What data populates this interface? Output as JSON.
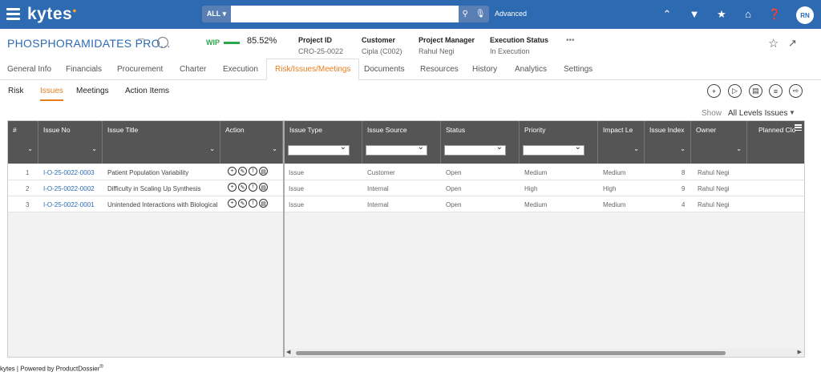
{
  "app": {
    "logo": "kytes",
    "logo_mark": "●"
  },
  "search": {
    "scope": "ALL ▾",
    "placeholder": "",
    "value": "",
    "advanced": "Advanced"
  },
  "user": {
    "initials": "RN"
  },
  "project": {
    "title": "PHOSPHORAMIDATES PRO...",
    "status_tag": "WIP",
    "progress_pct": "85.52%",
    "progress": 0.8552,
    "id_label": "Project ID",
    "id_value": "CRO-25-0022",
    "customer_label": "Customer",
    "customer_value": "Cipla (C002)",
    "manager_label": "Project Manager",
    "manager_value": "Rahul Negi",
    "exec_label": "Execution Status",
    "exec_value": "In Execution",
    "more": "•••"
  },
  "main_tabs": [
    "General Info",
    "Financials",
    "Procurement",
    "Charter",
    "Execution",
    "Risk/Issues/Meetings",
    "Documents",
    "Resources",
    "History",
    "Analytics",
    "Settings"
  ],
  "sub_tabs": [
    "Risk",
    "Issues",
    "Meetings",
    "Action Items"
  ],
  "filter": {
    "show_label": "Show",
    "level_value": "All Levels Issues"
  },
  "columns": [
    "#",
    "Issue No",
    "Issue Title",
    "Action",
    "Issue Type",
    "Issue Source",
    "Status",
    "Priority",
    "Impact Le",
    "Issue Index",
    "Owner",
    "Planned Clo"
  ],
  "rows": [
    {
      "num": "1",
      "issue_no": "I-O-25-0022-0003",
      "title": "Patient Population Variability",
      "type": "Issue",
      "source": "Customer",
      "status": "Open",
      "priority": "Medium",
      "impact": "Medium",
      "index": "8",
      "owner": "Rahul Negi"
    },
    {
      "num": "2",
      "issue_no": "I-O-25-0022-0002",
      "title": "Difficulty in Scaling Up Synthesis",
      "type": "Issue",
      "source": "Internal",
      "status": "Open",
      "priority": "High",
      "impact": "High",
      "index": "9",
      "owner": "Rahul Negi"
    },
    {
      "num": "3",
      "issue_no": "I-O-25-0022-0001",
      "title": "Unintended Interactions with Biological",
      "type": "Issue",
      "source": "Internal",
      "status": "Open",
      "priority": "Medium",
      "impact": "Medium",
      "index": "4",
      "owner": "Rahul Negi"
    }
  ],
  "footer": {
    "text": "kytes | Powered by ProductDossier",
    "mark": "®"
  },
  "colors": {
    "navbar": "#2d6ab2",
    "accent": "#e87d1e",
    "wip": "#2aa84a",
    "grid_header": "#555555"
  }
}
